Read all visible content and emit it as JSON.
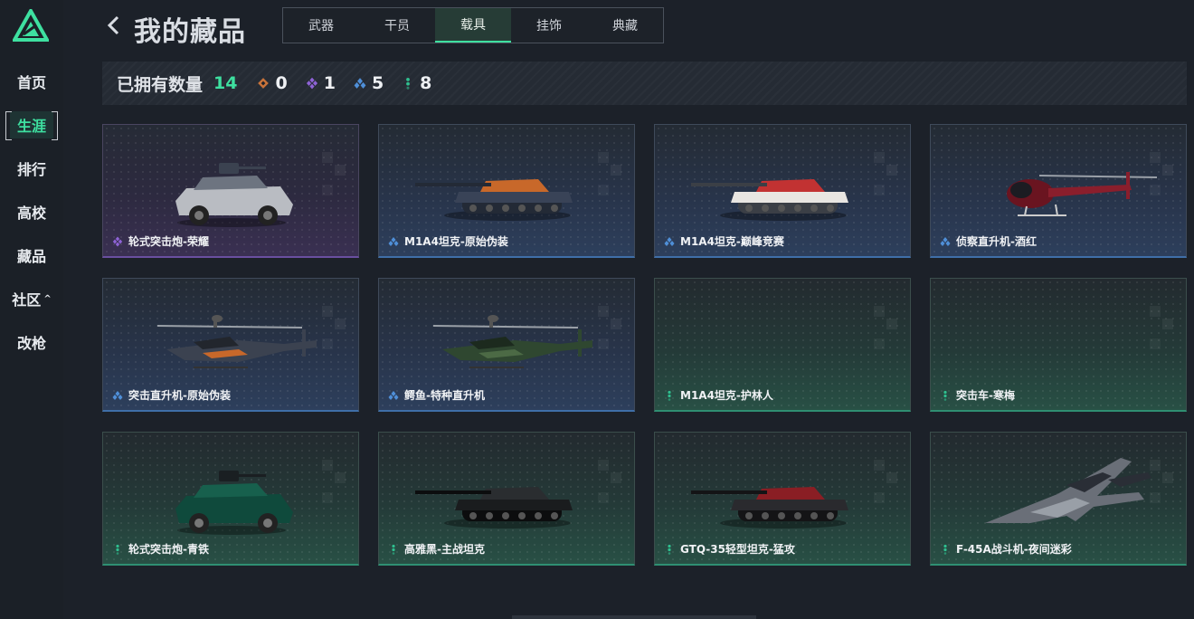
{
  "sidebar": {
    "items": [
      {
        "label": "首页",
        "active": false
      },
      {
        "label": "生涯",
        "active": true
      },
      {
        "label": "排行",
        "active": false
      },
      {
        "label": "高校",
        "active": false
      },
      {
        "label": "藏品",
        "active": false
      },
      {
        "label": "社区",
        "active": false
      },
      {
        "label": "改枪",
        "active": false
      }
    ],
    "community_caret": "^"
  },
  "header": {
    "title": "我的藏品",
    "tabs": [
      {
        "label": "武器"
      },
      {
        "label": "干员"
      },
      {
        "label": "载具",
        "active": true
      },
      {
        "label": "挂饰"
      },
      {
        "label": "典藏"
      }
    ]
  },
  "summary": {
    "owned_label": "已拥有数量",
    "owned_total": "14",
    "tiers": [
      {
        "icon": "orange-diamond-icon",
        "color": "#c8733a",
        "count": "0"
      },
      {
        "icon": "purple-diamond-icon",
        "color": "#8e63d6",
        "count": "1"
      },
      {
        "icon": "blue-diamond-icon",
        "color": "#4f8fd8",
        "count": "5"
      },
      {
        "icon": "green-dots-icon",
        "color": "#2fbf8f",
        "count": "8"
      }
    ]
  },
  "items": [
    {
      "name": "轮式突击炮-荣耀",
      "rarity": "purple",
      "kind": "armored-car"
    },
    {
      "name": "M1A4坦克-原始伪装",
      "rarity": "blue",
      "kind": "tank"
    },
    {
      "name": "M1A4坦克-巅峰竞赛",
      "rarity": "blue",
      "kind": "tank"
    },
    {
      "name": "侦察直升机-酒红",
      "rarity": "blue",
      "kind": "helicopter"
    },
    {
      "name": "突击直升机-原始伪装",
      "rarity": "blue",
      "kind": "attack-helicopter"
    },
    {
      "name": "鳄鱼-特种直升机",
      "rarity": "blue",
      "kind": "attack-helicopter"
    },
    {
      "name": "M1A4坦克-护林人",
      "rarity": "green",
      "kind": "none"
    },
    {
      "name": "突击车-寒梅",
      "rarity": "green",
      "kind": "none"
    },
    {
      "name": "轮式突击炮-青铁",
      "rarity": "green",
      "kind": "armored-car"
    },
    {
      "name": "高雅黑-主战坦克",
      "rarity": "green",
      "kind": "tank"
    },
    {
      "name": "GTQ-35轻型坦克-猛攻",
      "rarity": "green",
      "kind": "tank"
    },
    {
      "name": "F-45A战斗机-夜间迷彩",
      "rarity": "green",
      "kind": "jet"
    }
  ],
  "colors": {
    "accent": "#3ee0a0",
    "purple": "#8e63d6",
    "blue": "#4f8fd8",
    "green": "#2fbf8f"
  }
}
